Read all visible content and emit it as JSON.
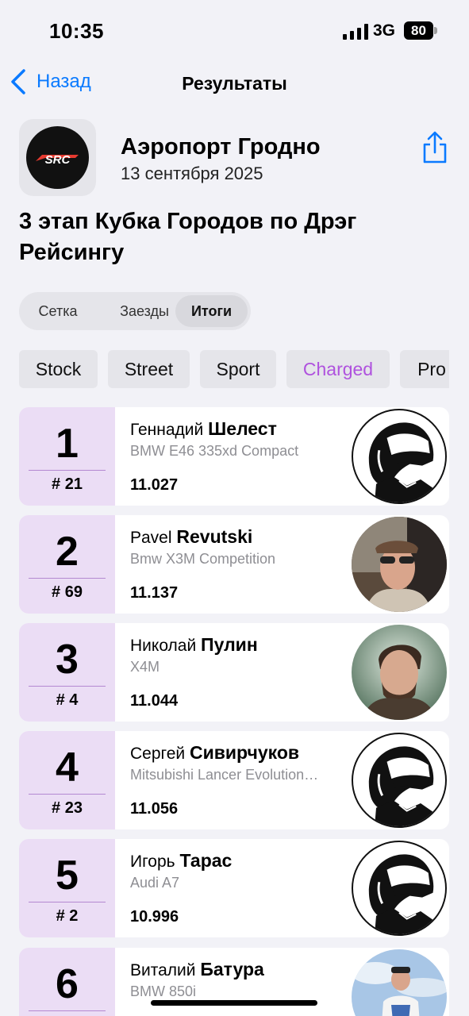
{
  "status_bar": {
    "time": "10:35",
    "network": "3G",
    "battery": "80"
  },
  "nav": {
    "back_label": "Назад",
    "title": "Результаты"
  },
  "event": {
    "logo_text": "SRC",
    "place": "Аэропорт Гродно",
    "date": "13 сентября 2025",
    "title": "3 этап Кубка Городов по Дрэг Рейсингу"
  },
  "segments": [
    {
      "label": "Сетка"
    },
    {
      "label": "Заезды"
    },
    {
      "label": "Итоги",
      "selected": true
    }
  ],
  "categories": [
    {
      "label": "Stock"
    },
    {
      "label": "Street"
    },
    {
      "label": "Sport"
    },
    {
      "label": "Charged",
      "selected": true
    },
    {
      "label": "Pro"
    }
  ],
  "results": [
    {
      "place": "1",
      "number": "# 21",
      "first_name": "Геннадий",
      "last_name": "Шелест",
      "car": "BMW E46 335xd Compact",
      "time": "11.027",
      "avatar": "helmet"
    },
    {
      "place": "2",
      "number": "# 69",
      "first_name": "Pavel",
      "last_name": "Revutski",
      "car": "Bmw X3M Competition",
      "time": "11.137",
      "avatar": "photo"
    },
    {
      "place": "3",
      "number": "# 4",
      "first_name": "Николай",
      "last_name": "Пулин",
      "car": "X4M",
      "time": "11.044",
      "avatar": "photo"
    },
    {
      "place": "4",
      "number": "# 23",
      "first_name": "Сергей",
      "last_name": "Сивирчуков",
      "car": "Mitsubishi Lancer Evolution…",
      "time": "11.056",
      "avatar": "helmet"
    },
    {
      "place": "5",
      "number": "# 2",
      "first_name": "Игорь",
      "last_name": "Тарас",
      "car": "Audi A7",
      "time": "10.996",
      "avatar": "helmet"
    },
    {
      "place": "6",
      "number": "",
      "first_name": "Виталий",
      "last_name": "Батура",
      "car": "BMW 850i",
      "time": "",
      "avatar": "photo"
    }
  ],
  "colors": {
    "accent": "#0A7AFF",
    "selected_category": "#AF52DE",
    "rank_bg": "#EBDDF5"
  }
}
